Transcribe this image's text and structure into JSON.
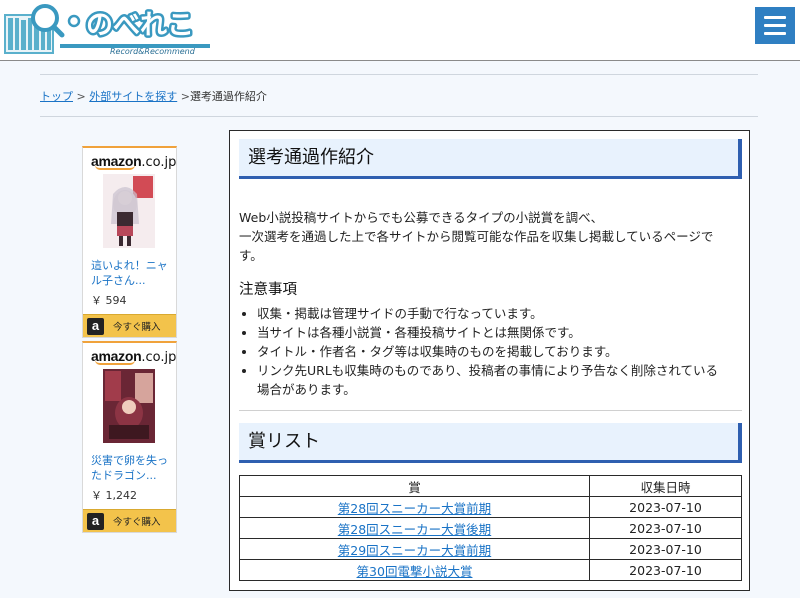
{
  "header": {
    "logo_text": "のべれこ",
    "logo_tagline": "Record&Recommend",
    "menu_icon": "hamburger-icon"
  },
  "breadcrumb": {
    "items": [
      "トップ",
      "外部サイトを探す",
      "選考通過作紹介"
    ],
    "separator": ">"
  },
  "ads": [
    {
      "brand": "amazon",
      "brand_suffix": ".co.jp",
      "title": "這いよれ！ニャル子さん...",
      "price": "￥ 594",
      "buy_label": "今すぐ購入",
      "cover_colors": [
        "#f3e6ea",
        "#c8494f",
        "#3a2a30"
      ]
    },
    {
      "brand": "amazon",
      "brand_suffix": ".co.jp",
      "title": "災害で卵を失ったドラゴン...",
      "price": "￥ 1,242",
      "buy_label": "今すぐ購入",
      "cover_colors": [
        "#9a3a48",
        "#5a2230",
        "#e0a7a0"
      ]
    }
  ],
  "main": {
    "title": "選考通過作紹介",
    "intro_lines": [
      "Web小説投稿サイトからでも公募できるタイプの小説賞を調べ、",
      "一次選考を通過した上で各サイトから閲覧可能な作品を収集し掲載しているページで",
      "す。"
    ],
    "notes_title": "注意事項",
    "notes": [
      "収集・掲載は管理サイドの手動で行なっています。",
      "当サイトは各種小説賞・各種投稿サイトとは無関係です。",
      "タイトル・作者名・タグ等は収集時のものを掲載しております。",
      "リンク先URLも収集時のものであり、投稿者の事情により予告なく削除されている",
      "場合があります。"
    ],
    "list_title": "賞リスト",
    "table": {
      "headers": [
        "賞",
        "収集日時"
      ],
      "rows": [
        [
          "第28回スニーカー大賞前期",
          "2023-07-10"
        ],
        [
          "第28回スニーカー大賞後期",
          "2023-07-10"
        ],
        [
          "第29回スニーカー大賞前期",
          "2023-07-10"
        ],
        [
          "第30回電撃小説大賞",
          "2023-07-10"
        ]
      ]
    }
  },
  "colors": {
    "accent": "#2f7fc2",
    "heading_bar": "#2f5fb0",
    "heading_bg": "#e8f2fd",
    "link": "#1a73c6",
    "buy_button": "#f3c34b"
  }
}
